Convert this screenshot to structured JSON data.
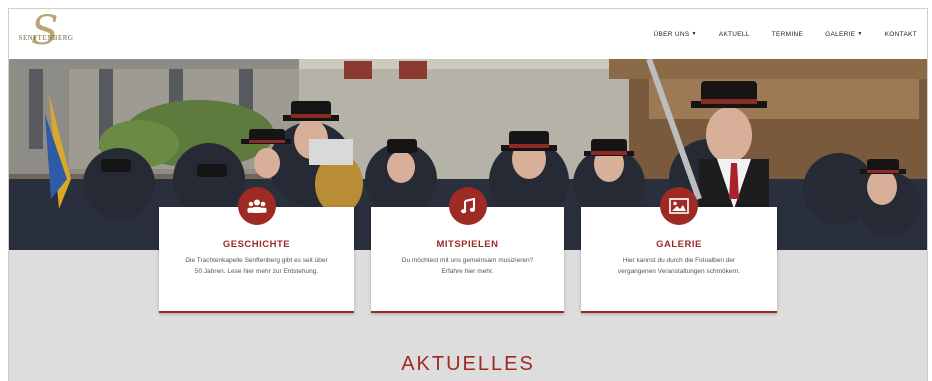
{
  "site": {
    "logo_word": "SENFTENBERG"
  },
  "nav": {
    "items": [
      {
        "label": "ÜBER UNS",
        "dropdown": true
      },
      {
        "label": "AKTUELL",
        "dropdown": false
      },
      {
        "label": "TERMINE",
        "dropdown": false
      },
      {
        "label": "GALERIE",
        "dropdown": true
      },
      {
        "label": "KONTAKT",
        "dropdown": false
      }
    ]
  },
  "cards": [
    {
      "icon": "group-icon",
      "title": "GESCHICHTE",
      "text": "Die Trachtenkapelle Senftenberg gibt es seit über 50 Jahren. Lese hier mehr zur Entstehung."
    },
    {
      "icon": "music-note-icon",
      "title": "MITSPIELEN",
      "text": "Du möchtest mit uns gemeinsam musizieren? Erfahre hier mehr."
    },
    {
      "icon": "image-icon",
      "title": "GALERIE",
      "text": "Hier kannst du durch die Fotoalben der vergangenen Veranstaltungen schmökern."
    }
  ],
  "section": {
    "heading": "AKTUELLES"
  },
  "colors": {
    "accent": "#9e2a24",
    "gold": "#b9a476",
    "section_bg": "#dddddd"
  }
}
